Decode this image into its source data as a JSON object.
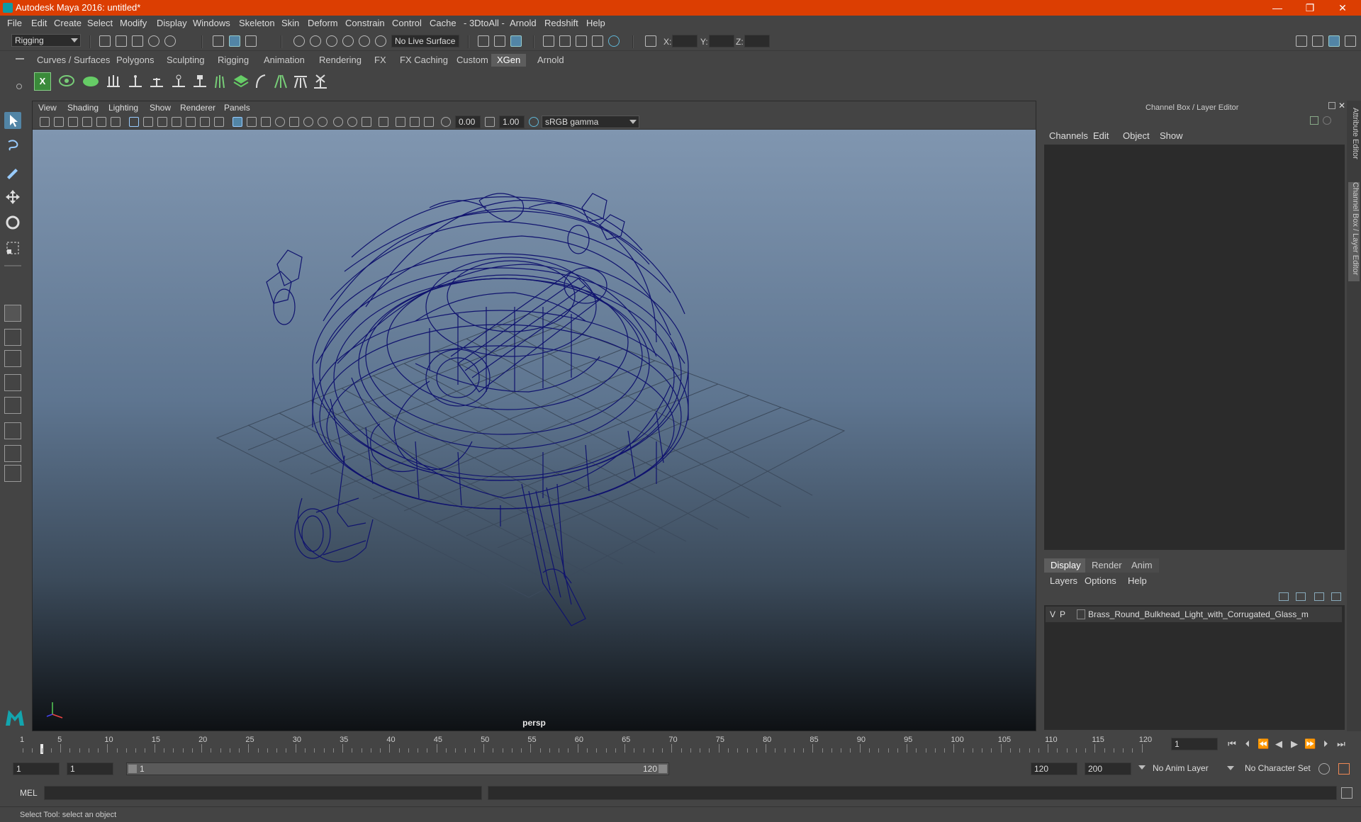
{
  "window": {
    "title": "Autodesk Maya 2016: untitled*",
    "minimize_glyph": "—",
    "restore_glyph": "❐",
    "close_glyph": "✕"
  },
  "menubar": [
    "File",
    "Edit",
    "Create",
    "Select",
    "Modify",
    "Display",
    "Windows",
    "Skeleton",
    "Skin",
    "Deform",
    "Constrain",
    "Control",
    "Cache",
    "- 3DtoAll -",
    "Arnold",
    "Redshift",
    "Help"
  ],
  "statusline": {
    "menuset": "Rigging",
    "live_surface": "No Live Surface",
    "x_label": "X:",
    "y_label": "Y:",
    "z_label": "Z:"
  },
  "shelf_tabs": [
    "Curves / Surfaces",
    "Polygons",
    "Sculpting",
    "Rigging",
    "Animation",
    "Rendering",
    "FX",
    "FX Caching",
    "Custom",
    "XGen",
    "Arnold"
  ],
  "shelf_active": "XGen",
  "viewport": {
    "menu": [
      "View",
      "Shading",
      "Lighting",
      "Show",
      "Renderer",
      "Panels"
    ],
    "exposure": "0.00",
    "gamma": "1.00",
    "color_space": "sRGB gamma",
    "camera_label": "persp"
  },
  "channel_box": {
    "header": "Channel Box / Layer Editor",
    "menu": [
      "Channels",
      "Edit",
      "Object",
      "Show"
    ]
  },
  "layer_editor": {
    "tabs": [
      "Display",
      "Render",
      "Anim"
    ],
    "menu": [
      "Layers",
      "Options",
      "Help"
    ],
    "layer": {
      "v": "V",
      "p": "P",
      "name": "Brass_Round_Bulkhead_Light_with_Corrugated_Glass_m"
    }
  },
  "side_tabs": [
    "Attribute Editor",
    "Channel Box / Layer Editor"
  ],
  "timeline": {
    "ticks": [
      "5",
      "10",
      "15",
      "20",
      "25",
      "30",
      "35",
      "40",
      "45",
      "50",
      "55",
      "60",
      "65",
      "70",
      "75",
      "80",
      "85",
      "90",
      "95",
      "100",
      "105",
      "110",
      "115",
      "120"
    ],
    "start_label": "1",
    "current_frame": "1"
  },
  "range": {
    "start": "1",
    "playback_start": "1",
    "slider_start": "1",
    "slider_end": "120",
    "playback_end": "120",
    "end": "200",
    "anim_layer": "No Anim Layer",
    "character_set": "No Character Set"
  },
  "command": {
    "label": "MEL"
  },
  "help_line": "Select Tool: select an object",
  "colors": {
    "title_bar": "#dc3e02",
    "accent": "#5285a6",
    "wireframe": "#10136e"
  }
}
